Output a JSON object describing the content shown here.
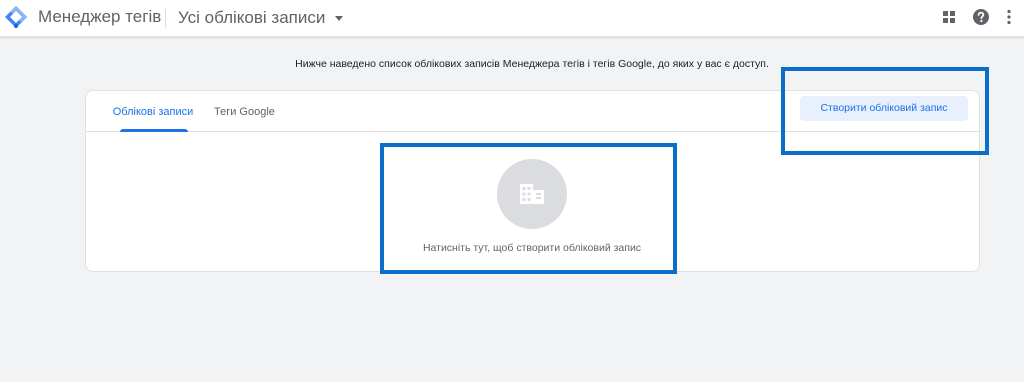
{
  "header": {
    "app_title": "Менеджер тегів",
    "account_selector": "Усі облікові записи",
    "icons": [
      "apps-grid-icon",
      "help-icon",
      "more-vert-icon"
    ],
    "logo_colors": [
      "#8ab4f8",
      "#4285f4",
      "#1967d2"
    ]
  },
  "main": {
    "intro_text": "Нижче наведено список облікових записів Менеджера тегів і тегів Google, до яких у вас є доступ.",
    "tabs": [
      {
        "label": "Облікові записи",
        "active": true
      },
      {
        "label": "Теги Google",
        "active": false
      }
    ],
    "create_button": "Створити обліковий запис",
    "empty_state": {
      "icon": "building-icon",
      "text": "Натисніть тут, щоб створити обліковий запис"
    }
  },
  "colors": {
    "accent": "#1a73e8",
    "highlight_border": "#0b6fc7",
    "background": "#f1f3f4"
  }
}
